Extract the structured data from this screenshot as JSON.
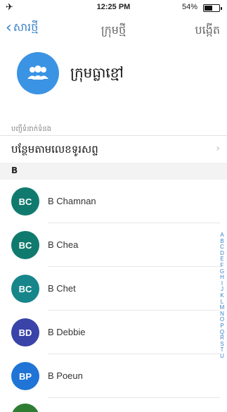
{
  "status_bar": {
    "time": "12:25 PM",
    "battery": "54%",
    "battery_level": 0.54,
    "airplane_icon": "airplane-icon"
  },
  "nav": {
    "back_label": "សារថ្មី",
    "title": "ក្រុមថ្មី",
    "create_label": "បង្កើត"
  },
  "group": {
    "name": "ក្រុមធ្លាខ្មៅ",
    "avatar_icon": "group-icon",
    "avatar_color": "#3b93e3"
  },
  "section": {
    "label": "បញ្ជីទំនាក់ទំនង",
    "add_by_phone": "បន្ថែមតាមលេខទូរសព្ទ"
  },
  "letter": "B",
  "contacts": [
    {
      "initials": "BC",
      "name": "B Chamnan",
      "color": "#117a6e"
    },
    {
      "initials": "BC",
      "name": "B Chea",
      "color": "#117a6e"
    },
    {
      "initials": "BC",
      "name": "B Chet",
      "color": "#16868a"
    },
    {
      "initials": "BD",
      "name": "B Debbie",
      "color": "#3a43a8"
    },
    {
      "initials": "BP",
      "name": "B Poeun",
      "color": "#1f74d6"
    }
  ],
  "alpha_index": [
    "A",
    "B",
    "C",
    "D",
    "E",
    "F",
    "G",
    "H",
    "I",
    "J",
    "K",
    "L",
    "M",
    "N",
    "O",
    "P",
    "Q",
    "R",
    "S",
    "T",
    "U"
  ]
}
